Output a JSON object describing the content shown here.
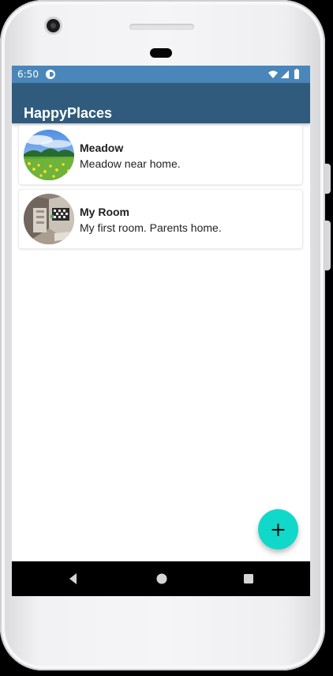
{
  "status_bar": {
    "time": "6:50",
    "notification_icon": "sync-notification-icon",
    "system_icons": [
      "wifi-icon",
      "cellular-signal-icon",
      "battery-icon"
    ]
  },
  "app_bar": {
    "title": "HappyPlaces",
    "color": "#305b7d",
    "status_color": "#4a86b9"
  },
  "places": [
    {
      "title": "Meadow",
      "description": "Meadow near home.",
      "image_icon": "meadow-photo"
    },
    {
      "title": "My Room",
      "description": "My first room. Parents home.",
      "image_icon": "room-photo"
    }
  ],
  "fab": {
    "label": "+",
    "icon": "add-icon",
    "color": "#10d9c9"
  },
  "navigation": {
    "back_icon": "back-icon",
    "home_icon": "home-icon",
    "recents_icon": "recents-icon"
  }
}
